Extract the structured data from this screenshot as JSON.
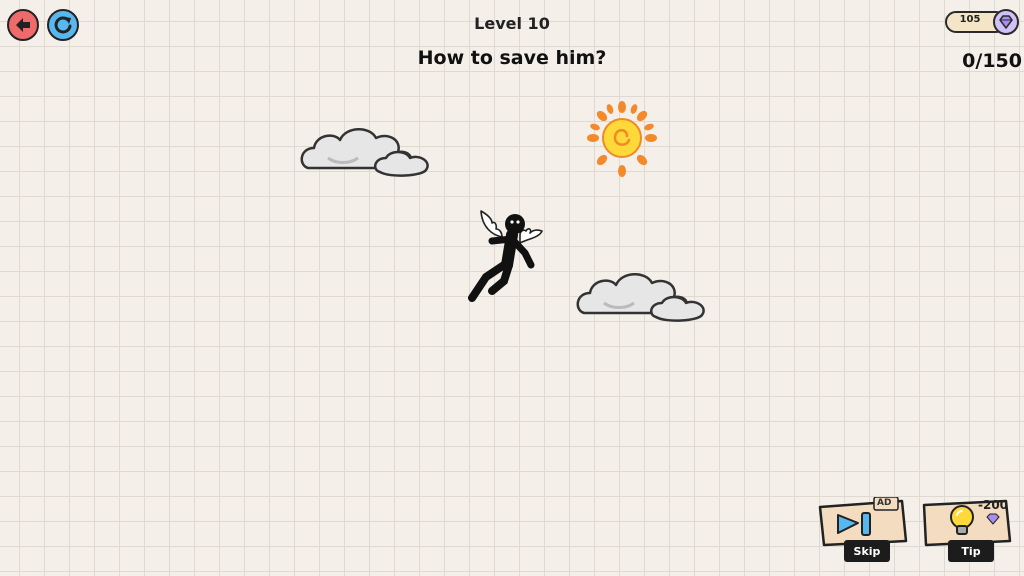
{
  "header": {
    "level_label": "Level 10",
    "question": "How to save him?",
    "progress": "0/150"
  },
  "currency": {
    "gems": "105"
  },
  "toolbar": {
    "skip_label": "Skip",
    "skip_badge": "AD",
    "tip_label": "Tip",
    "tip_cost": "-200"
  },
  "icons": {
    "back": "back-arrow-icon",
    "restart": "restart-icon",
    "gem": "gem-icon"
  },
  "colors": {
    "back_button": "#ef6b6b",
    "restart_button": "#57b7ee",
    "sun": "#ffd83a",
    "sun_rays": "#f4892b",
    "gem": "#a98ef0",
    "cloud": "#e6e6e6"
  }
}
